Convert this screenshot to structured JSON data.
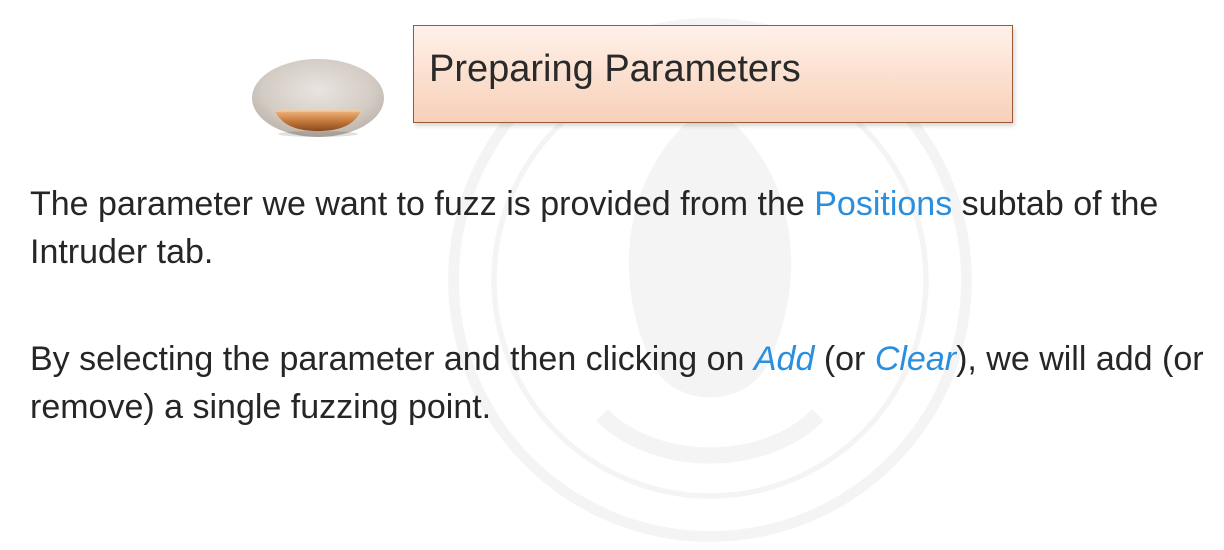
{
  "slide": {
    "title": "Preparing Parameters",
    "paragraph1": {
      "before": "The parameter we want to fuzz is provided from the ",
      "highlight": "Positions",
      "after": " subtab of the Intruder tab."
    },
    "paragraph2": {
      "part1": "By selecting the parameter and then clicking on ",
      "add": "Add",
      "part2": " (or ",
      "clear": "Clear",
      "part3": "), we will add (or remove) a single fuzzing point."
    }
  },
  "colors": {
    "highlight": "#2a8fde",
    "title_border": "#9b5a36",
    "title_fill_top": "#fff1e9",
    "title_fill_bottom": "#f7d0b8",
    "bowl_copper": "#c57a3d"
  },
  "icons": {
    "decoration": "bowl-icon",
    "watermark": "emblem-watermark"
  }
}
